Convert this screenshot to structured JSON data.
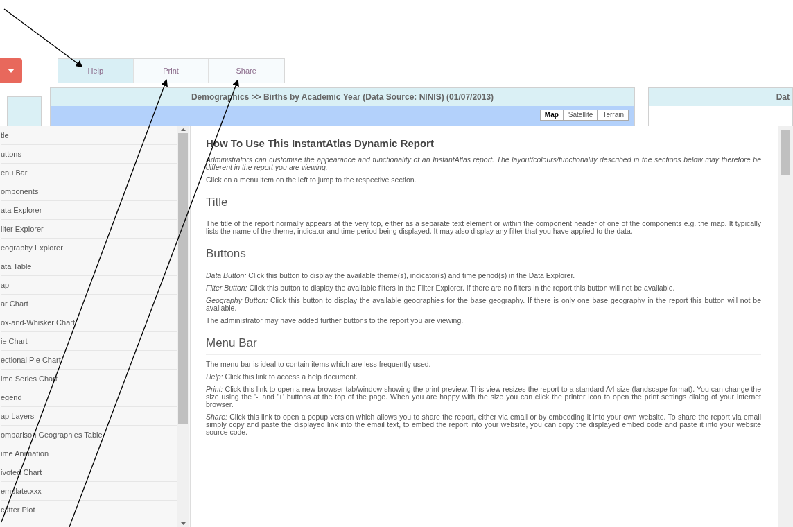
{
  "menu_tabs": [
    {
      "label": "Help",
      "selected": true
    },
    {
      "label": "Print",
      "selected": false
    },
    {
      "label": "Share",
      "selected": false
    }
  ],
  "map_panel": {
    "title": "Demographics >> Births by Academic Year (Data Source: NINIS) (01/07/2013)",
    "map_types": [
      {
        "label": "Map",
        "selected": true
      },
      {
        "label": "Satellite",
        "selected": false
      },
      {
        "label": "Terrain",
        "selected": false
      }
    ]
  },
  "right_panel": {
    "title": "Dat"
  },
  "help_sidebar": {
    "items": [
      "tle",
      "uttons",
      "enu Bar",
      "omponents",
      "ata Explorer",
      "ilter Explorer",
      "eography Explorer",
      "ata Table",
      "ap",
      "ar Chart",
      "ox-and-Whisker Chart",
      "ie Chart",
      "ectional Pie Chart",
      "ime Series Chart",
      "egend",
      "ap Layers",
      "omparison Geographies Table",
      "ime Animation",
      "ivoted Chart",
      "emplate.xxx",
      "catter Plot"
    ]
  },
  "help_content": {
    "title": "How To Use This InstantAtlas Dynamic Report",
    "sections": [
      {
        "paragraphs": [
          {
            "kind": "note",
            "text": "Administrators can customise the appearance and functionality of an InstantAtlas report. The layout/colours/functionality described in the sections below may therefore be different in the report you are viewing."
          },
          {
            "kind": "plain",
            "text": "Click on a menu item on the left to jump to the respective section."
          }
        ]
      },
      {
        "heading": "Title",
        "paragraphs": [
          {
            "kind": "plain",
            "text": "The title of the report normally appears at the very top, either as a separate text element or within the component header of one of the components e.g. the map. It typically lists the name of the theme, indicator and time period being displayed. It may also display any filter that you have applied to the data."
          }
        ]
      },
      {
        "heading": "Buttons",
        "paragraphs": [
          {
            "kind": "plain",
            "text": "*Data Button:* Click this button to display the available theme(s), indicator(s) and time period(s) in the Data Explorer."
          },
          {
            "kind": "plain",
            "text": "*Filter Button:* Click this button to display the available filters in the Filter Explorer. If there are no filters in the report this button will not be available."
          },
          {
            "kind": "plain",
            "text": "*Geography Button:* Click this button to display the available geographies for the base geography. If there is only one base geography in the report this button will not be available."
          },
          {
            "kind": "plain",
            "text": "The administrator may have added further buttons to the report you are viewing."
          }
        ]
      },
      {
        "heading": "Menu Bar",
        "paragraphs": [
          {
            "kind": "plain",
            "text": "The menu bar is ideal to contain items which are less frequently used."
          },
          {
            "kind": "plain",
            "text": "*Help:* Click this link to access a help document."
          },
          {
            "kind": "plain",
            "text": "*Print:* Click this link to open a new browser tab/window showing the print preview. This view resizes the report to a standard A4 size (landscape format). You can change the size using the '-' and '+' buttons at the top of the page. When you are happy with the size you can click the printer icon to open the print settings dialog of your internet browser."
          },
          {
            "kind": "plain",
            "text": "*Share:* Click this link to open a popup version which allows you to share the report, either via email or by embedding it into your own website. To share the report via email simply copy and paste the displayed link into the email text, to embed the report into your website, you can copy the displayed embed code and paste it into your website source code."
          }
        ]
      }
    ]
  }
}
